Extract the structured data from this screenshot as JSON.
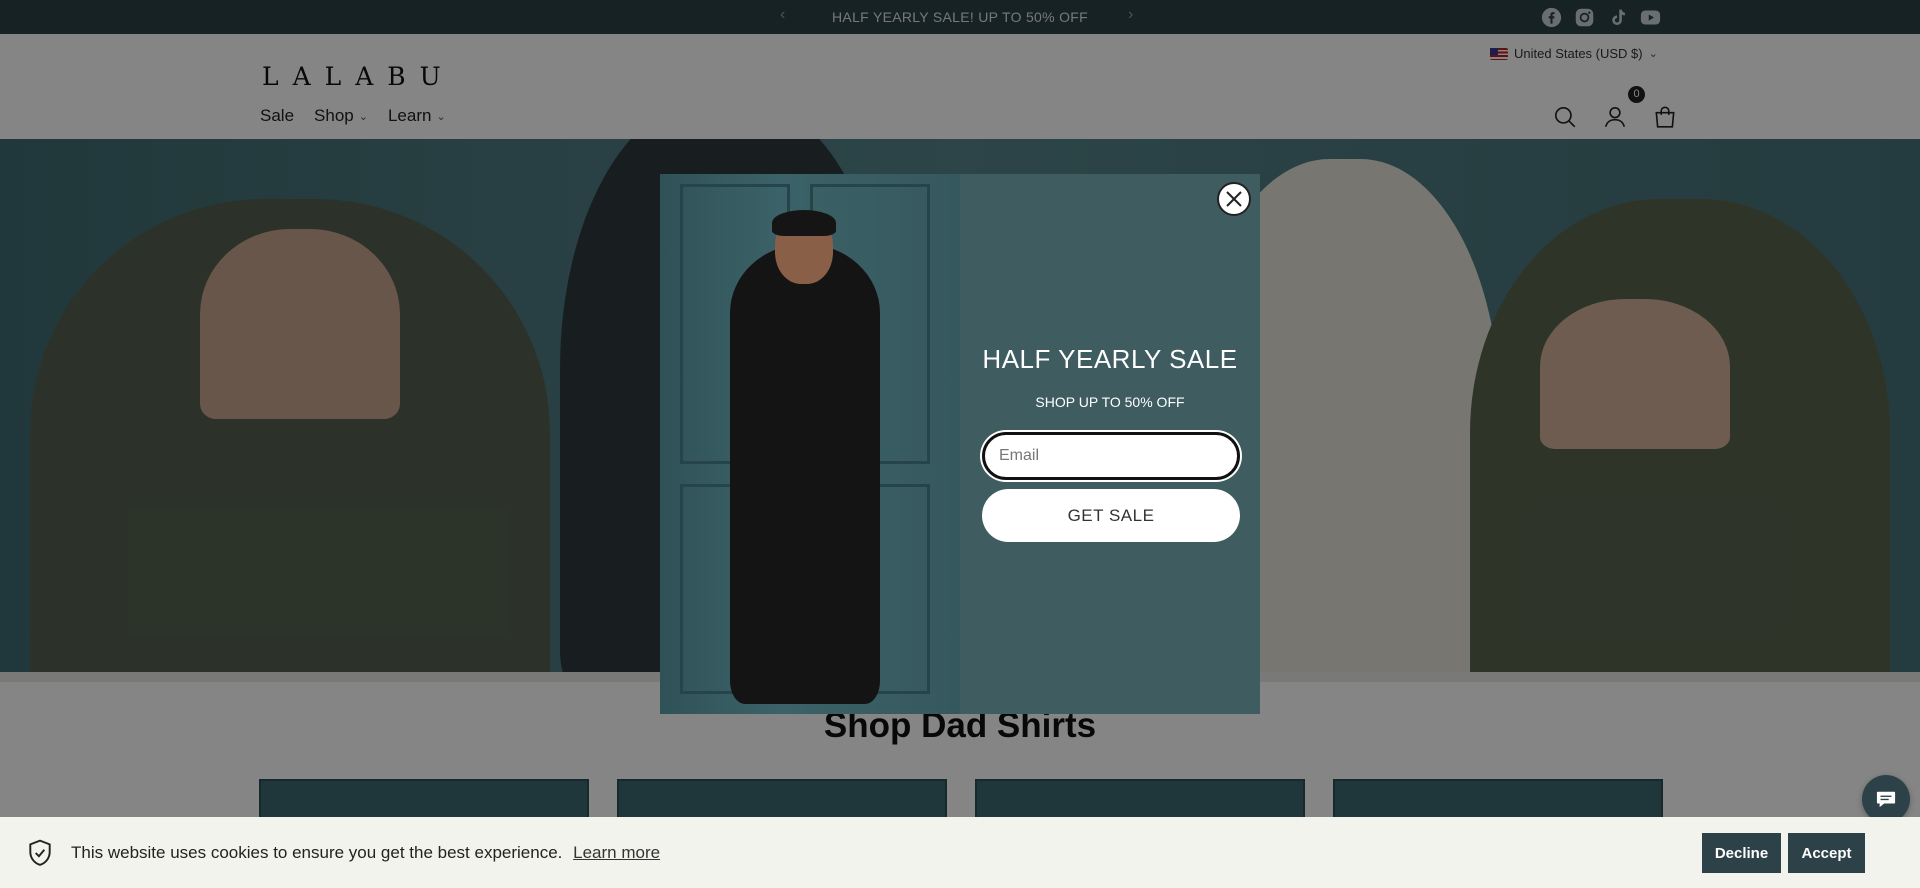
{
  "announcement": {
    "message": "HALF YEARLY SALE! UP TO 50% OFF",
    "prev_icon": "chevron-left",
    "next_icon": "chevron-right",
    "socials": [
      "facebook-icon",
      "instagram-icon",
      "tiktok-icon",
      "youtube-icon"
    ]
  },
  "header": {
    "logo": "LALABU",
    "country_selector": "United States (USD $)",
    "nav": [
      {
        "label": "Sale"
      },
      {
        "label": "Shop"
      },
      {
        "label": "Learn"
      }
    ],
    "cart_count": "0"
  },
  "section": {
    "title": "Shop Dad Shirts"
  },
  "popup": {
    "title": "HALF YEARLY SALE",
    "subtitle": "SHOP UP TO 50% OFF",
    "email_placeholder": "Email",
    "cta_label": "GET SALE"
  },
  "cookie": {
    "text": "This website uses cookies to ensure you get the best experience.",
    "learn_more": "Learn more",
    "decline": "Decline",
    "accept": "Accept"
  },
  "colors": {
    "brand_dark": "#2d4148",
    "popup_bg": "#3f5c61",
    "cookie_bg": "#f3f3ee"
  }
}
